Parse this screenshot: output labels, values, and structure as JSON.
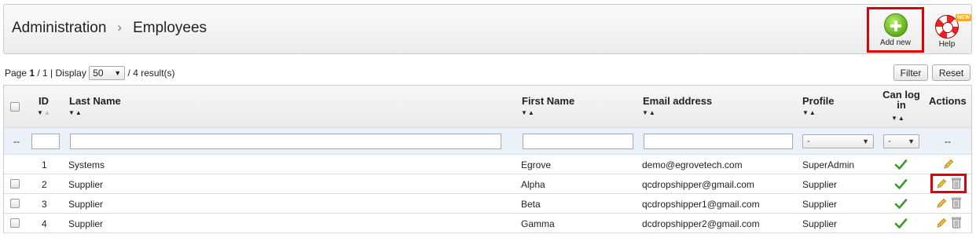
{
  "breadcrumb": {
    "root": "Administration",
    "current": "Employees"
  },
  "toolbar": {
    "add_new_label": "Add new",
    "help_label": "Help",
    "help_badge": "NEW"
  },
  "pager": {
    "page_prefix": "Page ",
    "page": "1",
    "page_suffix": " / 1 | Display ",
    "display_value": "50",
    "results_text": " / 4 result(s)"
  },
  "buttons": {
    "filter": "Filter",
    "reset": "Reset"
  },
  "columns": {
    "id": "ID",
    "last_name": "Last Name",
    "first_name": "First Name",
    "email": "Email address",
    "profile": "Profile",
    "can_log_in_1": "Can log",
    "can_log_in_2": "in",
    "actions": "Actions"
  },
  "filters": {
    "row_marker": "--",
    "profile_value": "-",
    "can_log_value": "-",
    "actions_marker": "--"
  },
  "rows": [
    {
      "id": "1",
      "last_name": "Systems",
      "first_name": "Egrove",
      "email": "demo@egrovetech.com",
      "profile": "SuperAdmin",
      "can_log_in": true,
      "deletable": false
    },
    {
      "id": "2",
      "last_name": "Supplier",
      "first_name": "Alpha",
      "email": "qcdropshipper@gmail.com",
      "profile": "Supplier",
      "can_log_in": true,
      "deletable": true
    },
    {
      "id": "3",
      "last_name": "Supplier",
      "first_name": "Beta",
      "email": "qcdropshipper1@gmail.com",
      "profile": "Supplier",
      "can_log_in": true,
      "deletable": true
    },
    {
      "id": "4",
      "last_name": "Supplier",
      "first_name": "Gamma",
      "email": "dcdropshipper2@gmail.com",
      "profile": "Supplier",
      "can_log_in": true,
      "deletable": true
    }
  ],
  "colors": {
    "accent_green": "#5fae16",
    "highlight_red": "#e00000",
    "filter_bg": "#eaf1f9"
  },
  "icons": [
    "chevron-right-icon",
    "plus-circle-icon",
    "lifebuoy-icon",
    "checkmark-icon",
    "pencil-icon",
    "trash-icon",
    "sort-arrows-icon"
  ]
}
